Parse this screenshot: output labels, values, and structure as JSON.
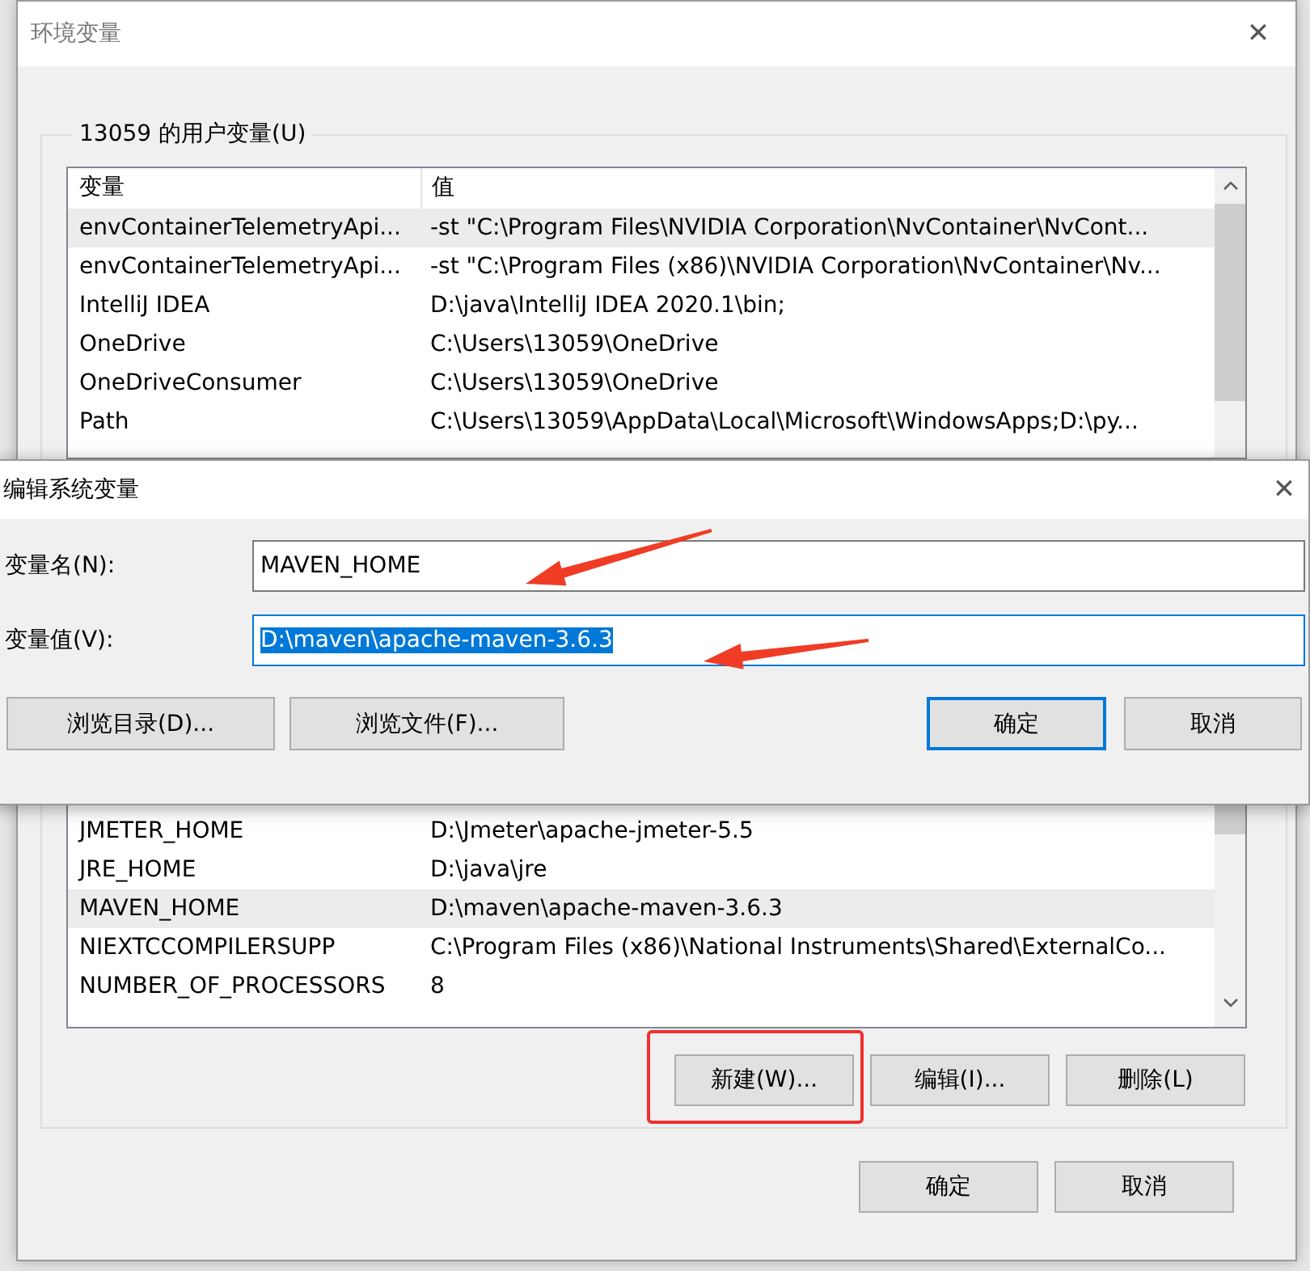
{
  "env_window": {
    "title": "环境变量",
    "close": "✕",
    "user_group": {
      "label": "13059 的用户变量(U)",
      "columns": [
        "变量",
        "值"
      ],
      "rows": [
        {
          "name": "envContainerTelemetryApi...",
          "value": "-st \"C:\\Program Files\\NVIDIA Corporation\\NvContainer\\NvCont...",
          "selected": true
        },
        {
          "name": "envContainerTelemetryApi...",
          "value": "-st \"C:\\Program Files (x86)\\NVIDIA Corporation\\NvContainer\\Nv...",
          "selected": false
        },
        {
          "name": "IntelliJ IDEA",
          "value": "D:\\java\\IntelliJ IDEA 2020.1\\bin;",
          "selected": false
        },
        {
          "name": "OneDrive",
          "value": "C:\\Users\\13059\\OneDrive",
          "selected": false
        },
        {
          "name": "OneDriveConsumer",
          "value": "C:\\Users\\13059\\OneDrive",
          "selected": false
        },
        {
          "name": "Path",
          "value": "C:\\Users\\13059\\AppData\\Local\\Microsoft\\WindowsApps;D:\\py...",
          "selected": false
        }
      ]
    },
    "system_list": {
      "rows": [
        {
          "name": "JMETER_HOME",
          "value": "D:\\Jmeter\\apache-jmeter-5.5",
          "selected": false
        },
        {
          "name": "JRE_HOME",
          "value": "D:\\java\\jre",
          "selected": false
        },
        {
          "name": "MAVEN_HOME",
          "value": "D:\\maven\\apache-maven-3.6.3",
          "selected": true
        },
        {
          "name": "NIEXTCCOMPILERSUPP",
          "value": "C:\\Program Files (x86)\\National Instruments\\Shared\\ExternalCo...",
          "selected": false
        },
        {
          "name": "NUMBER_OF_PROCESSORS",
          "value": "8",
          "selected": false
        }
      ],
      "buttons": [
        "新建(W)...",
        "编辑(I)...",
        "删除(L)"
      ]
    },
    "buttons": [
      "确定",
      "取消"
    ]
  },
  "edit_dialog": {
    "title": "编辑系统变量",
    "close": "✕",
    "fields": [
      {
        "label": "变量名(N):",
        "value": "MAVEN_HOME",
        "focused": false,
        "selected": false
      },
      {
        "label": "变量值(V):",
        "value": "D:\\maven\\apache-maven-3.6.3",
        "focused": true,
        "selected": true
      }
    ],
    "buttons": [
      {
        "label": "浏览目录(D)...",
        "default": false
      },
      {
        "label": "浏览文件(F)...",
        "default": false
      },
      {
        "label": "确定",
        "default": true
      },
      {
        "label": "取消",
        "default": false
      }
    ]
  },
  "annotations": [
    {
      "kind": "arrow"
    },
    {
      "kind": "arrow"
    },
    {
      "kind": "frame"
    }
  ]
}
